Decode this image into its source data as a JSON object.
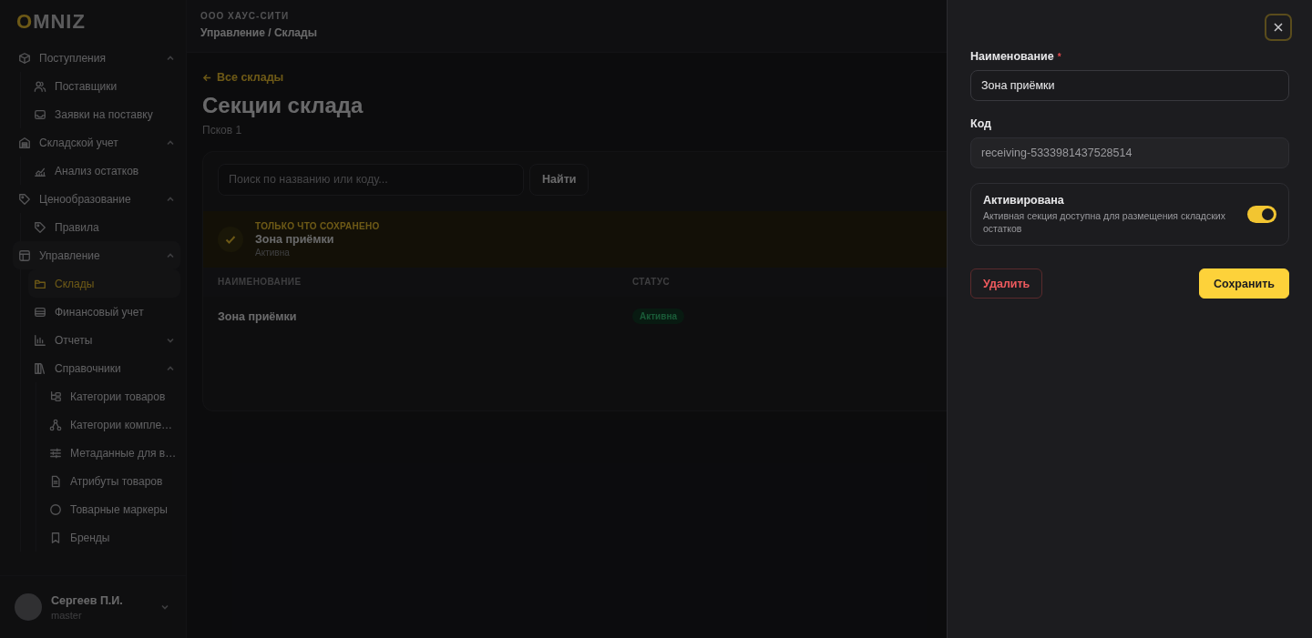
{
  "sidebar": {
    "logo": {
      "accent": "O",
      "rest": "MNIZ"
    },
    "nav": [
      {
        "label": "Поступления",
        "expanded": true,
        "selected": false,
        "children": [
          {
            "label": "Поставщики",
            "selected": false
          },
          {
            "label": "Заявки на поставку",
            "selected": false
          }
        ]
      },
      {
        "label": "Складской учет",
        "expanded": true,
        "selected": false,
        "children": [
          {
            "label": "Анализ остатков",
            "selected": false
          }
        ]
      },
      {
        "label": "Ценообразование",
        "expanded": true,
        "selected": false,
        "children": [
          {
            "label": "Правила",
            "selected": false
          }
        ]
      },
      {
        "label": "Управление",
        "expanded": true,
        "selected": false,
        "children": [
          {
            "label": "Склады",
            "selected": true
          },
          {
            "label": "Финансовый учет",
            "selected": false
          },
          {
            "label": "Отчеты",
            "expanded": false,
            "selected": false
          },
          {
            "label": "Справочники",
            "expanded": true,
            "selected": false,
            "children": [
              {
                "label": "Категории товаров",
                "selected": false
              },
              {
                "label": "Категории компле…",
                "selected": false
              },
              {
                "label": "Метаданные для в…",
                "selected": false
              },
              {
                "label": "Атрибуты товаров",
                "selected": false
              },
              {
                "label": "Товарные маркеры",
                "selected": false
              },
              {
                "label": "Бренды",
                "selected": false
              }
            ]
          }
        ]
      }
    ],
    "user": {
      "name": "Сергеев П.И.",
      "role": "master"
    }
  },
  "header": {
    "org": "ООО ХАУС-СИТИ",
    "breadcrumb": "Управление / Склады"
  },
  "page": {
    "back_link": "Все склады",
    "title": "Секции склада",
    "subtitle": "Псков 1",
    "search": {
      "placeholder": "Поиск по названию или коду...",
      "button": "Найти"
    },
    "saved_notice": {
      "label": "ТОЛЬКО ЧТО СОХРАНЕНО",
      "name": "Зона приёмки",
      "status": "Активна"
    },
    "table": {
      "columns": [
        "НАИМЕНОВАНИЕ",
        "СТАТУС"
      ],
      "rows": [
        {
          "name": "Зона приёмки",
          "status": "Активна"
        }
      ]
    }
  },
  "drawer": {
    "fields": [
      {
        "label": "Наименование",
        "required_mark": "*",
        "value": "Зона приёмки",
        "disabled": false
      },
      {
        "label": "Код",
        "value": "receiving-5333981437528514",
        "disabled": true
      }
    ],
    "toggle": {
      "title": "Активирована",
      "description": "Активная секция доступна для размещения складских остатков",
      "on": true
    },
    "buttons": [
      {
        "kind": "danger",
        "label": "Удалить"
      },
      {
        "kind": "primary",
        "label": "Сохранить"
      }
    ]
  }
}
